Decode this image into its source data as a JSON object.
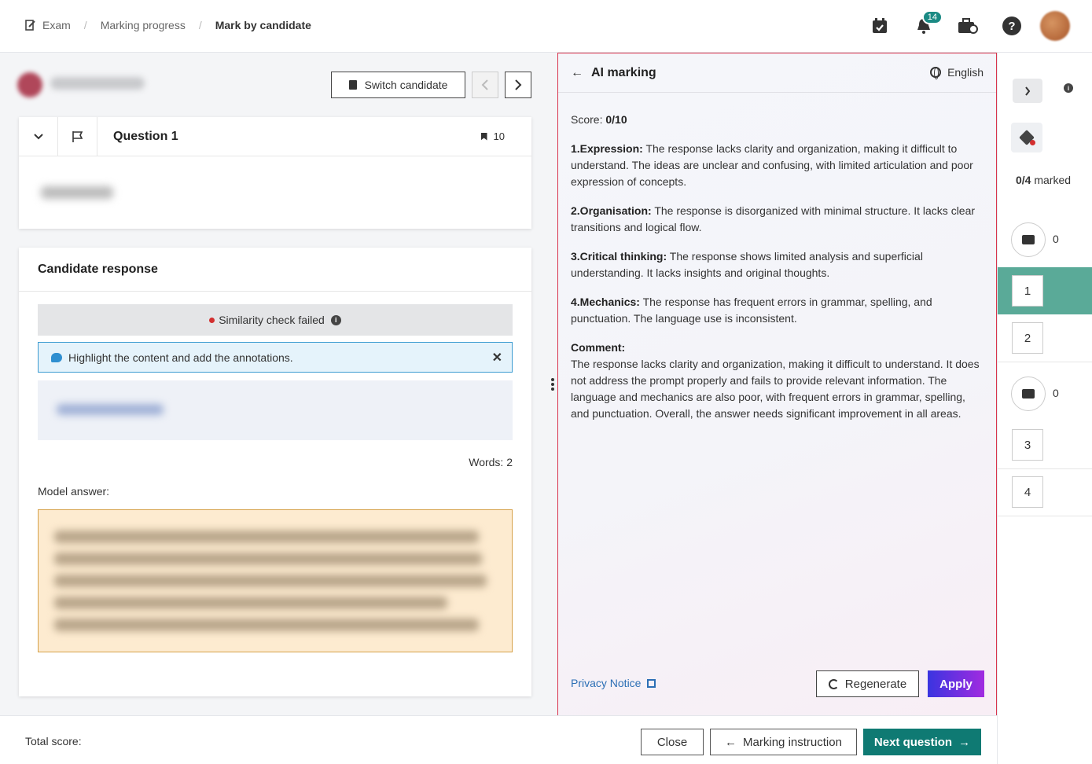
{
  "breadcrumb": {
    "items": [
      "Exam",
      "Marking progress",
      "Mark by candidate"
    ]
  },
  "header": {
    "notification_count": "14"
  },
  "candidate": {
    "switch_label": "Switch candidate"
  },
  "question": {
    "title": "Question 1",
    "marks": "10"
  },
  "response": {
    "title": "Candidate response",
    "similarity": "Similarity check failed",
    "hint": "Highlight the content and add the annotations.",
    "words": "Words: 2",
    "model_label": "Model answer:"
  },
  "ai": {
    "title": "AI marking",
    "language": "English",
    "score_label": "Score:",
    "score_value": "0/10",
    "criteria": [
      {
        "label": "1.Expression:",
        "text": "The response lacks clarity and organization, making it difficult to understand. The ideas are unclear and confusing, with limited articulation and poor expression of concepts."
      },
      {
        "label": "2.Organisation:",
        "text": "The response is disorganized with minimal structure. It lacks clear transitions and logical flow."
      },
      {
        "label": "3.Critical thinking:",
        "text": "The response shows limited analysis and superficial understanding. It lacks insights and original thoughts."
      },
      {
        "label": "4.Mechanics:",
        "text": "The response has frequent errors in grammar, spelling, and punctuation. The language use is inconsistent."
      }
    ],
    "comment_label": "Comment:",
    "comment": "The response lacks clarity and organization, making it difficult to understand. It does not address the prompt properly and fails to provide relevant information. The language and mechanics are also poor, with frequent errors in grammar, spelling, and punctuation. Overall, the answer needs significant improvement in all areas.",
    "privacy": "Privacy Notice",
    "regenerate": "Regenerate",
    "apply": "Apply"
  },
  "sidebar": {
    "marked_count": "0/4",
    "marked_label": "marked",
    "sections": [
      {
        "count": "0",
        "questions": [
          "1",
          "2"
        ]
      },
      {
        "count": "0",
        "questions": [
          "3",
          "4"
        ]
      }
    ]
  },
  "footer": {
    "total_label": "Total score:",
    "close": "Close",
    "instruction": "Marking instruction",
    "next": "Next question"
  },
  "colors": {
    "accent": "#0f7a73",
    "panel_border": "#d9344d",
    "active_row": "#5aaa98",
    "apply_gradient": [
      "#3a34e0",
      "#a12be0"
    ]
  },
  "icons": [
    "exam-icon",
    "calendar-check-icon",
    "bell-icon",
    "briefcase-icon",
    "help-icon",
    "switch-candidate-icon",
    "chevron-left-icon",
    "chevron-right-icon",
    "chevron-down-icon",
    "flag-icon",
    "bookmark-icon",
    "info-icon",
    "chat-icon",
    "close-icon",
    "arrow-left-icon",
    "globe-icon",
    "external-link-icon",
    "refresh-icon",
    "arrow-right-icon",
    "ai-pen-icon",
    "section-icon"
  ]
}
